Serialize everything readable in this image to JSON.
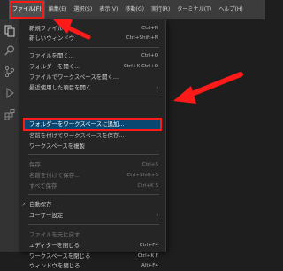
{
  "menubar": {
    "items": [
      {
        "label": "ファイル(F)"
      },
      {
        "label": "編集(E)"
      },
      {
        "label": "選択(S)"
      },
      {
        "label": "表示(V)"
      },
      {
        "label": "移動(G)"
      },
      {
        "label": "実行(R)"
      },
      {
        "label": "ターミナル(T)"
      },
      {
        "label": "ヘルプ(H)"
      }
    ]
  },
  "file_menu": {
    "items": [
      {
        "label": "新規ファイル",
        "shortcut": "Ctrl+N"
      },
      {
        "label": "新しいウィンドウ",
        "shortcut": "Ctrl+Shift+N"
      },
      {
        "label": "ファイルを開く...",
        "shortcut": "Ctrl+O"
      },
      {
        "label": "フォルダーを開く...",
        "shortcut": "Ctrl+K Ctrl+O"
      },
      {
        "label": "ファイルでワークスペースを開く..."
      },
      {
        "label": "最近使用した項目を開く"
      },
      {
        "label": "フォルダーをワークスペースに追加..."
      },
      {
        "label": "名前を付けてワークスペースを保存..."
      },
      {
        "label": "ワークスペースを複製"
      },
      {
        "label": "保存",
        "shortcut": "Ctrl+S"
      },
      {
        "label": "名前を付けて保存...",
        "shortcut": "Ctrl+Shift+S"
      },
      {
        "label": "すべて保存",
        "shortcut": "Ctrl+K S"
      },
      {
        "label": "自動保存"
      },
      {
        "label": "ユーザー設定"
      },
      {
        "label": "ファイルを元に戻す"
      },
      {
        "label": "エディターを閉じる",
        "shortcut": "Ctrl+F4"
      },
      {
        "label": "ワークスペースを閉じる",
        "shortcut": "Ctrl+K F"
      },
      {
        "label": "ウィンドウを閉じる",
        "shortcut": "Alt+F4"
      }
    ]
  },
  "colors": {
    "highlight": "#094771",
    "annotation": "#ff1a1a",
    "menubar_bg": "#3c3c3c",
    "menu_bg": "#252526"
  }
}
